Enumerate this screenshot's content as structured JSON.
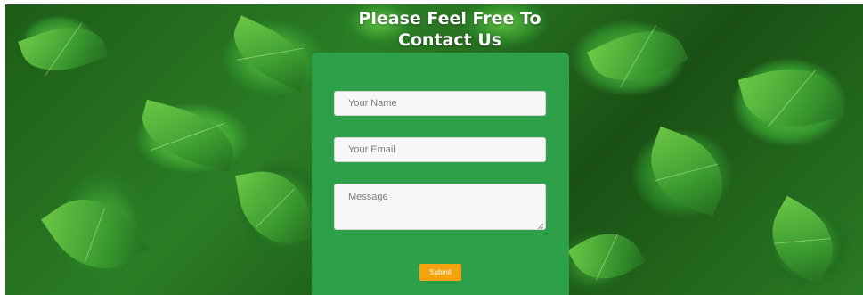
{
  "page": {
    "title": "Please Feel Free To Contact Us",
    "background_image": "green-leaves-background"
  },
  "form": {
    "name_placeholder": "Your Name",
    "email_placeholder": "Your Email",
    "message_placeholder": "Message",
    "name_value": "",
    "email_value": "",
    "message_value": "",
    "submit_label": "Submit"
  },
  "colors": {
    "form_background": "#2fa04a",
    "submit_background": "#f5a20f",
    "title_color": "#ffffff",
    "input_background": "#f7f7f7"
  }
}
